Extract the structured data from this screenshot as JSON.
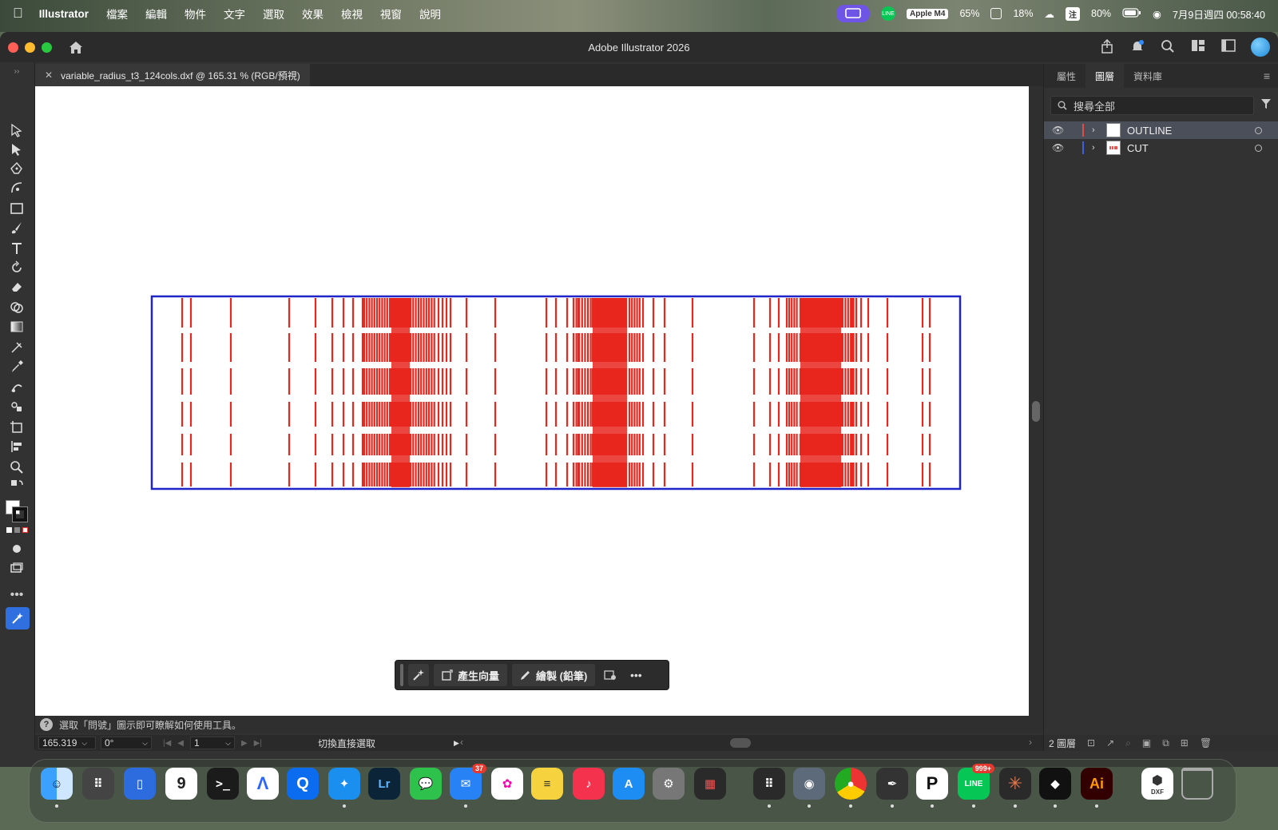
{
  "menubar": {
    "app_name": "Illustrator",
    "items": [
      "檔案",
      "編輯",
      "物件",
      "文字",
      "選取",
      "效果",
      "檢視",
      "視窗",
      "說明"
    ],
    "status": {
      "memory_badge": "Apple M4",
      "cpu": "65%",
      "gpu": "18%",
      "input_method": "注",
      "battery": "80%",
      "clock": "7月9日週四 00:58:40"
    }
  },
  "window": {
    "title": "Adobe Illustrator 2026",
    "doc_tab": "variable_radius_t3_124cols.dxf @ 165.31 % (RGB/預視)"
  },
  "colors": {
    "outline_blue": "#1f25c8",
    "cut_red": "#e8271e",
    "accent": "#2f6fe0"
  },
  "context_bar": {
    "generate_vector": "產生向量",
    "draw_pencil": "繪製 (鉛筆)"
  },
  "hint_bar": {
    "text": "選取「問號」圖示即可瞭解如何使用工具。"
  },
  "status_bar": {
    "zoom": "165.319",
    "rotation": "0°",
    "artboard": "1",
    "tool_state": "切換直接選取"
  },
  "right_panel": {
    "tabs": [
      "屬性",
      "圖層",
      "資料庫"
    ],
    "active_tab": "圖層",
    "search_placeholder": "搜尋全部",
    "layers": [
      {
        "name": "OUTLINE",
        "color": "#e34b4b"
      },
      {
        "name": "CUT",
        "color": "#3e5fe0"
      }
    ],
    "footer_count": "2 圖層"
  },
  "dock": {
    "calendar_day": "9",
    "mail_badge": "37",
    "line_badge": "999+",
    "lightroom": "Lr",
    "illustrator": "Ai",
    "dxf_label": "DXF"
  }
}
